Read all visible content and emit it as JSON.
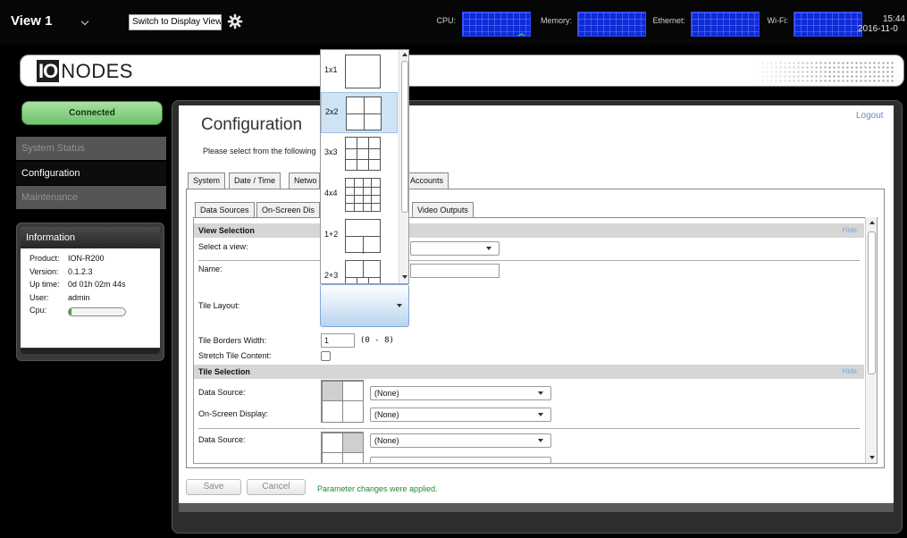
{
  "topbar": {
    "view_title": "View 1",
    "display_button": "Switch to Display View",
    "meters": [
      {
        "label": "CPU:",
        "icon": "cpu-graph",
        "level": 0.05
      },
      {
        "label": "Memory:",
        "icon": "memory-graph",
        "level": 0.55
      },
      {
        "label": "Ethernet:",
        "icon": "ethernet-graph",
        "level": 0
      },
      {
        "label": "Wi-Fi:",
        "icon": "wifi-graph",
        "level": 0
      }
    ],
    "clock_time": "15:44",
    "clock_date": "2016-11-0"
  },
  "brand": {
    "logo_mark": "IO",
    "logo_text": "NODES"
  },
  "sidebar": {
    "connection_status": "Connected",
    "items": [
      {
        "label": "System Status",
        "active": false
      },
      {
        "label": "Configuration",
        "active": true
      },
      {
        "label": "Maintenance",
        "active": false
      }
    ],
    "info": {
      "title": "Information",
      "rows": [
        {
          "key": "Product:",
          "value": "ION-R200"
        },
        {
          "key": "Version:",
          "value": "0.1.2.3"
        },
        {
          "key": "Up time:",
          "value": "0d 01h 02m 44s"
        },
        {
          "key": "User:",
          "value": "admin"
        },
        {
          "key": "Cpu:",
          "value": ""
        }
      ],
      "cpu_level": 0.04
    }
  },
  "main": {
    "title": "Configuration",
    "logout": "Logout",
    "intro": "Please select from the following",
    "tabs": [
      "System",
      "Date / Time",
      "Netwo",
      "Accounts"
    ],
    "subtabs": [
      "Data Sources",
      "On-Screen Dis",
      "Video Outputs"
    ],
    "view_selection": {
      "heading": "View Selection",
      "hide": "Hide",
      "select_view_label": "Select a view:",
      "name_label": "Name:",
      "tile_layout_label": "Tile Layout:",
      "tile_borders_label": "Tile Borders Width:",
      "tile_borders_value": "1",
      "tile_borders_range": "(0 - 8)",
      "stretch_label": "Stretch Tile Content:",
      "stretch_checked": false
    },
    "tile_selection": {
      "heading": "Tile Selection",
      "hide": "Hide",
      "data_source_label": "Data Source:",
      "osd_label": "On-Screen Display:",
      "data_source_value": "(None)",
      "osd_value": "(None)",
      "data_source_label_2": "Data Source:",
      "data_source_value_2": "(None)"
    },
    "buttons": {
      "save": "Save",
      "cancel": "Cancel"
    },
    "status_message": "Parameter changes were applied."
  },
  "tile_layout_dropdown": {
    "selected": "2x2",
    "options": [
      "1x1",
      "2x2",
      "3x3",
      "4x4",
      "1+2",
      "2+3"
    ]
  },
  "colors": {
    "connected": "#6ec36b",
    "meter_blue": "#0f2bd8",
    "meter_green": "#19c64b",
    "link_blue": "#5b8ec9",
    "success_green": "#1f8a2e"
  }
}
